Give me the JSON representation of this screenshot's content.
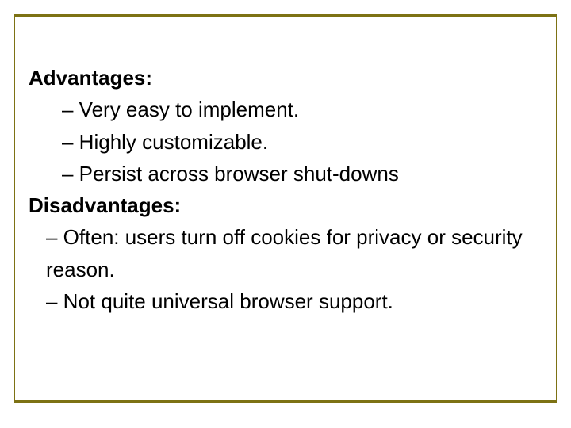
{
  "slide": {
    "advantages": {
      "heading": "Advantages:",
      "items": [
        "– Very easy to implement.",
        "– Highly customizable.",
        "– Persist across browser shut-downs"
      ]
    },
    "disadvantages": {
      "heading": "Disadvantages:",
      "items": [
        "– Often: users turn off cookies for privacy or security reason.",
        "– Not quite universal browser support."
      ]
    }
  }
}
